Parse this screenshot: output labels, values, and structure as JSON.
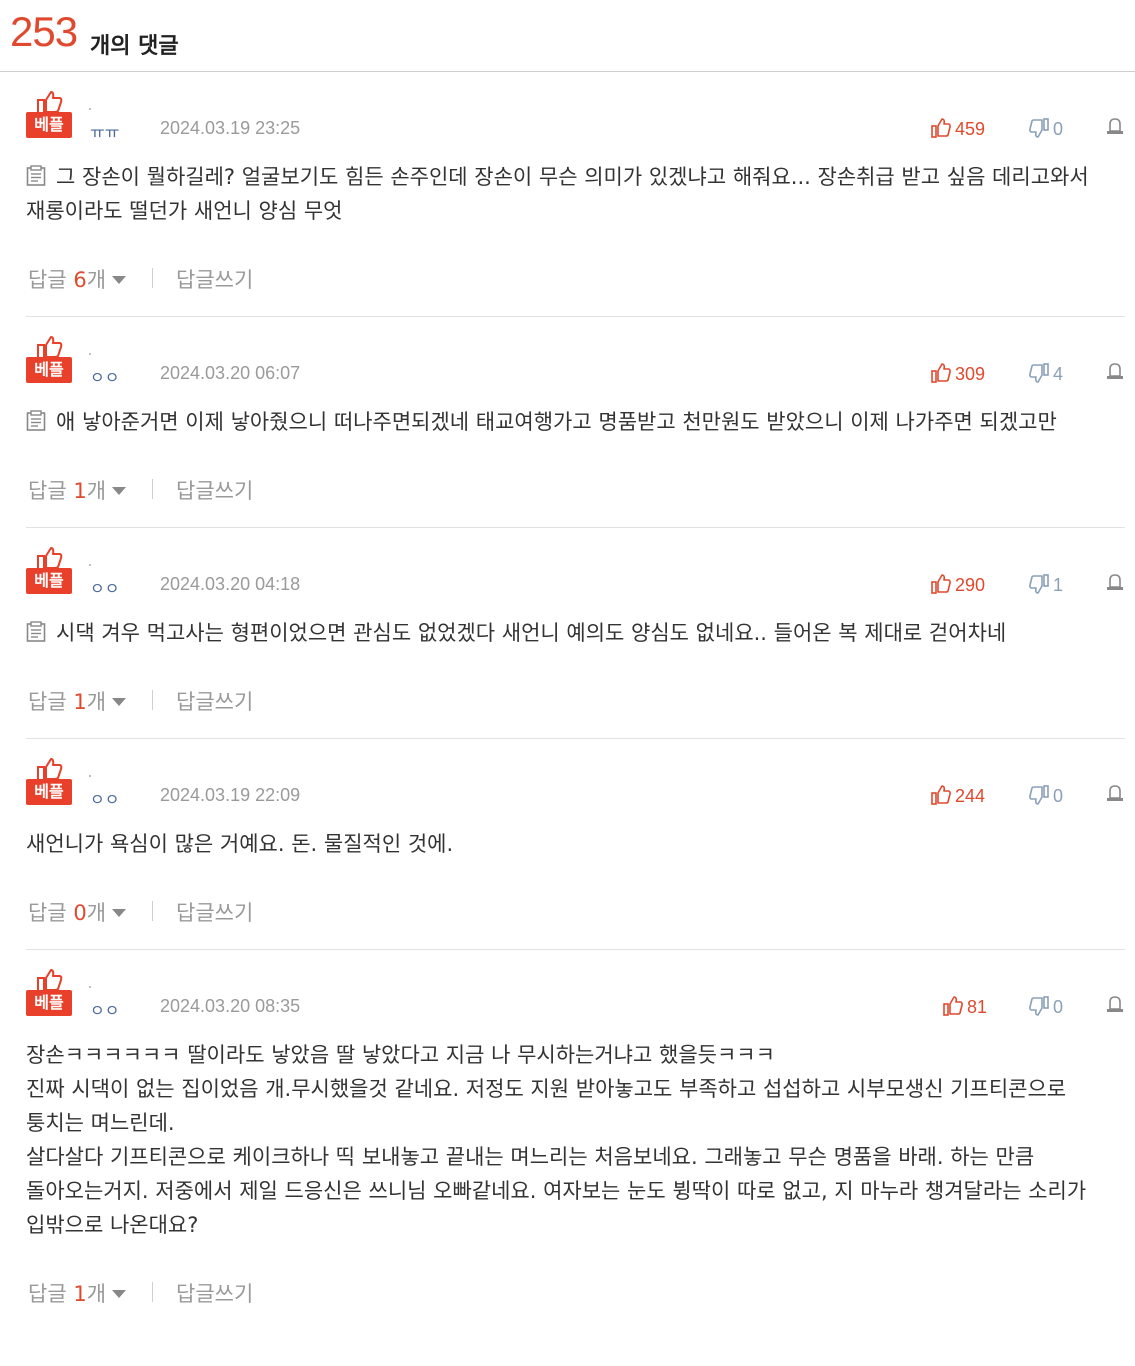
{
  "header": {
    "count": "253",
    "count_label": "개의 댓글"
  },
  "comments": [
    {
      "badge": "베플",
      "nick": "ㅠㅠ",
      "date": "2024.03.19 23:25",
      "likes": "459",
      "dislikes": "0",
      "has_memo_icon": true,
      "text": "그 장손이 뭘하길레? 얼굴보기도 힘든 손주인데 장손이 무슨 의미가 있겠냐고 해줘요... 장손취급 받고 싶음 데리고와서 재롱이라도 떨던가 새언니 양심 무엇",
      "reply_label": "답글",
      "reply_count": "6",
      "reply_unit": "개",
      "write_label": "답글쓰기"
    },
    {
      "badge": "베플",
      "nick": "ㅇㅇ",
      "date": "2024.03.20 06:07",
      "likes": "309",
      "dislikes": "4",
      "has_memo_icon": true,
      "text": "애 낳아준거면 이제 낳아줬으니 떠나주면되겠네 태교여행가고 명품받고 천만원도 받았으니 이제 나가주면 되겠고만",
      "reply_label": "답글",
      "reply_count": "1",
      "reply_unit": "개",
      "write_label": "답글쓰기"
    },
    {
      "badge": "베플",
      "nick": "ㅇㅇ",
      "date": "2024.03.20 04:18",
      "likes": "290",
      "dislikes": "1",
      "has_memo_icon": true,
      "text": "시댁 겨우 먹고사는 형편이었으면 관심도 없었겠다 새언니 예의도 양심도 없네요.. 들어온 복 제대로 걷어차네",
      "reply_label": "답글",
      "reply_count": "1",
      "reply_unit": "개",
      "write_label": "답글쓰기"
    },
    {
      "badge": "베플",
      "nick": "ㅇㅇ",
      "date": "2024.03.19 22:09",
      "likes": "244",
      "dislikes": "0",
      "has_memo_icon": false,
      "text": "새언니가 욕심이 많은 거예요. 돈. 물질적인 것에.",
      "reply_label": "답글",
      "reply_count": "0",
      "reply_unit": "개",
      "write_label": "답글쓰기"
    },
    {
      "badge": "베플",
      "nick": "ㅇㅇ",
      "date": "2024.03.20 08:35",
      "likes": "81",
      "dislikes": "0",
      "has_memo_icon": false,
      "text": "장손ㅋㅋㅋㅋㅋㅋ 딸이라도 낳았음 딸 낳았다고 지금 나 무시하는거냐고 했을듯ㅋㅋㅋ\n진짜 시댁이 없는 집이었음 개.무시했을것 같네요. 저정도 지원 받아놓고도 부족하고 섭섭하고 시부모생신 기프티콘으로 퉁치는 며느린데.\n살다살다 기프티콘으로 케이크하나 띡 보내놓고 끝내는 며느리는 처음보네요. 그래놓고 무슨 명품을 바래. 하는 만큼 돌아오는거지. 저중에서 제일 드응신은 쓰니님 오빠같네요. 여자보는 눈도 뷩딱이 따로 없고, 지 마누라 챙겨달라는 소리가 입밖으로 나온대요?",
      "reply_label": "답글",
      "reply_count": "1",
      "reply_unit": "개",
      "write_label": "답글쓰기"
    }
  ]
}
